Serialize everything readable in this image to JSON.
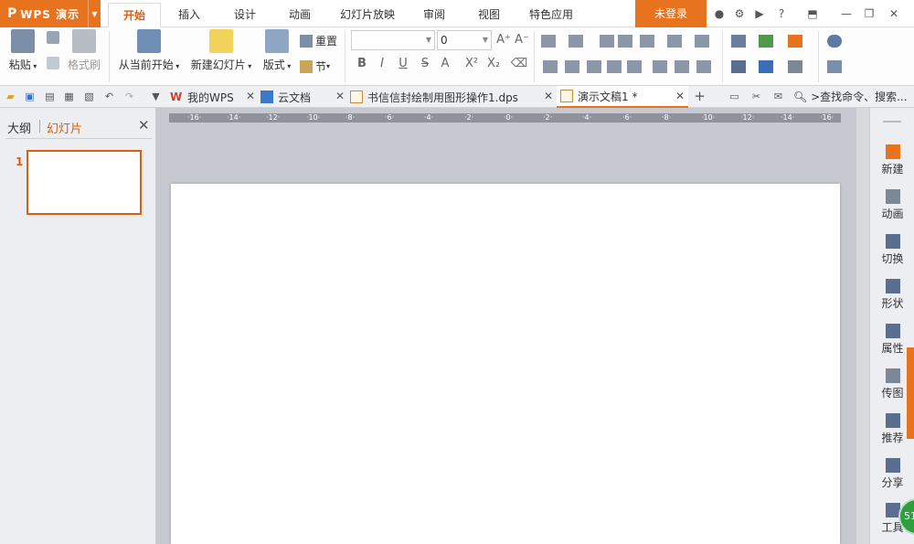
{
  "app": {
    "logo": "P",
    "name": "WPS 演示"
  },
  "menu": {
    "tabs": [
      {
        "label": "开始",
        "active": true
      },
      {
        "label": "插入"
      },
      {
        "label": "设计"
      },
      {
        "label": "动画"
      },
      {
        "label": "幻灯片放映"
      },
      {
        "label": "审阅"
      },
      {
        "label": "视图"
      },
      {
        "label": "特色应用"
      }
    ],
    "login": "未登录"
  },
  "ribbon": {
    "paste": "粘贴",
    "format_painter": "格式刷",
    "from_current": "从当前开始",
    "new_slide": "新建幻灯片",
    "layout": "版式",
    "reset": "重置",
    "section": "节",
    "font_size": "0",
    "bold": "B",
    "italic": "I",
    "underline": "U",
    "strike": "S",
    "font_color": "A",
    "superscript": "X²",
    "subscript": "X₂"
  },
  "doc_tabs": [
    {
      "label": "我的WPS",
      "icon": "wps-logo-icon"
    },
    {
      "label": "云文档",
      "icon": "cloud-doc-icon"
    },
    {
      "label": "书信信封绘制用图形操作1.dps",
      "icon": "dps-file-icon"
    },
    {
      "label": "演示文稿1 *",
      "icon": "presentation-file-icon",
      "active": true
    }
  ],
  "search_cmd": ">查找命令、搜索...",
  "left_pane": {
    "tab_outline": "大纲",
    "tab_slides": "幻灯片",
    "slide_number": "1"
  },
  "ruler_labels": [
    "16",
    "14",
    "12",
    "10",
    "8",
    "6",
    "4",
    "2",
    "0",
    "2",
    "4",
    "6",
    "8",
    "10",
    "12",
    "14",
    "16"
  ],
  "right_panel": [
    {
      "label": "新建",
      "icon": "new-doc-icon"
    },
    {
      "label": "动画",
      "icon": "animation-icon"
    },
    {
      "label": "切换",
      "icon": "transition-icon"
    },
    {
      "label": "形状",
      "icon": "shape-icon"
    },
    {
      "label": "属性",
      "icon": "property-icon"
    },
    {
      "label": "传图",
      "icon": "upload-image-icon"
    },
    {
      "label": "推荐",
      "icon": "recommend-icon"
    },
    {
      "label": "分享",
      "icon": "share-icon"
    },
    {
      "label": "工具",
      "icon": "toolbox-icon"
    }
  ],
  "badge": "51",
  "colors": {
    "accent": "#e8731f",
    "ruler": "#8f9399",
    "workspace": "#c7c9d1"
  }
}
